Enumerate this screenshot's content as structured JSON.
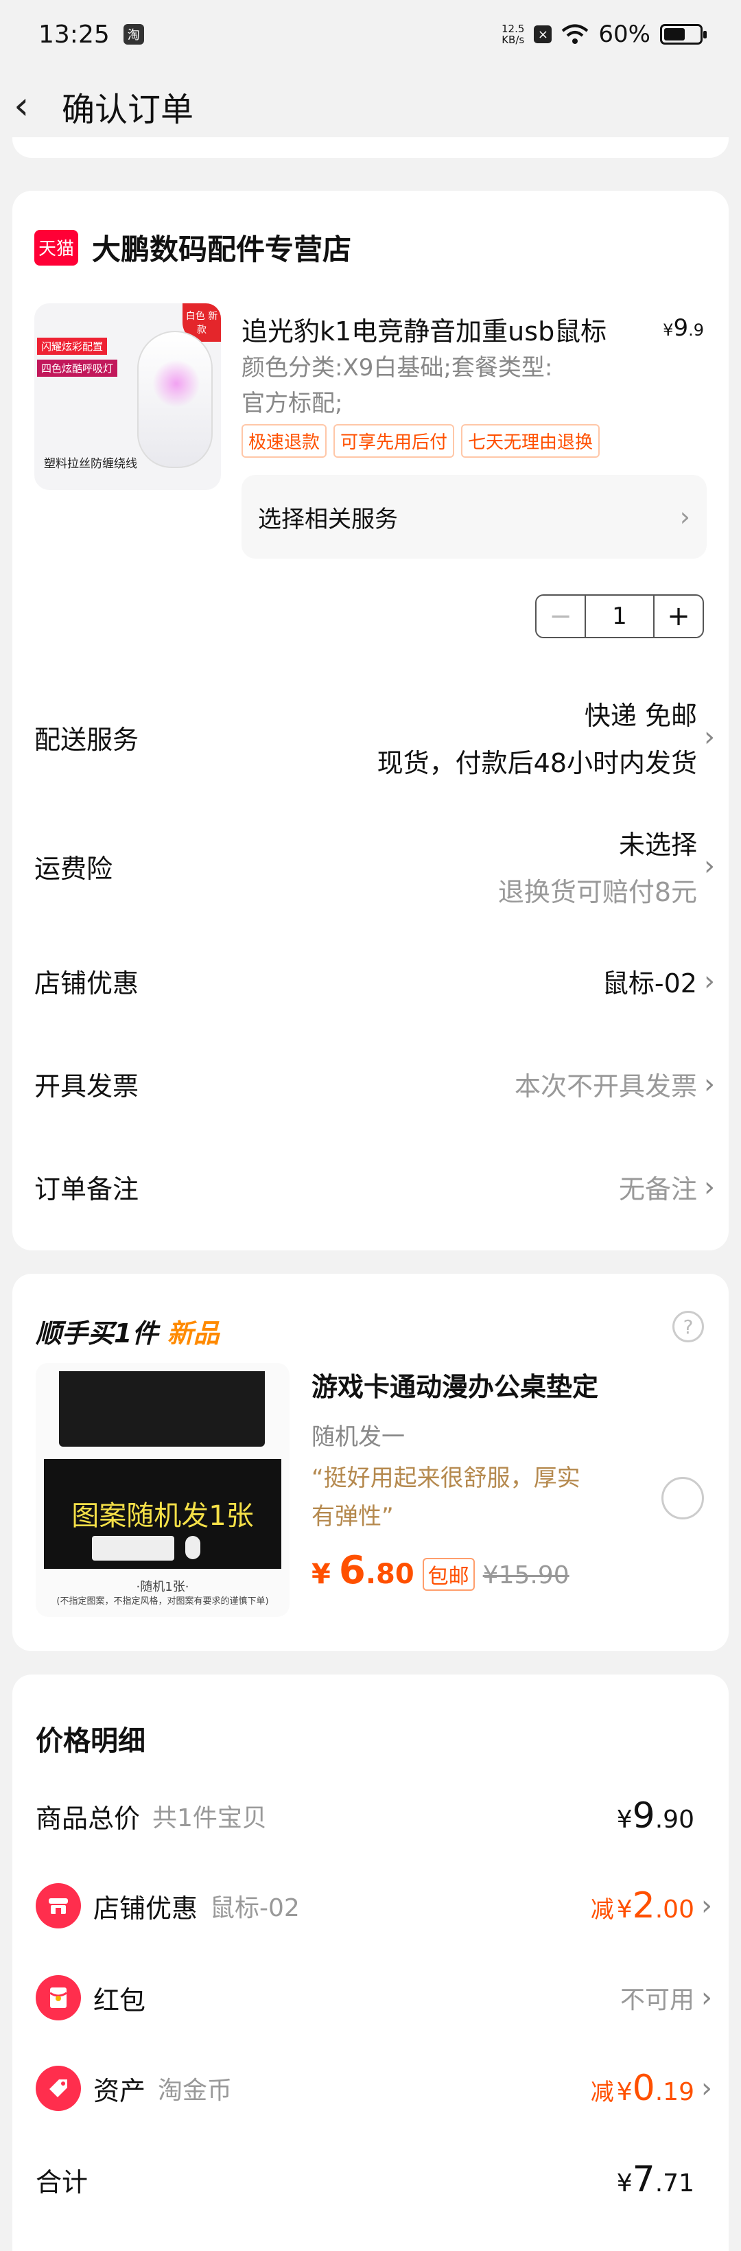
{
  "status": {
    "time": "13:25",
    "app_icon": "淘",
    "netspeed_value": "12.5",
    "netspeed_unit": "KB/s",
    "battery": "60%",
    "battery_level": 0.6
  },
  "nav": {
    "title": "确认订单"
  },
  "shop": {
    "badge": "天猫",
    "name": "大鹏数码配件专营店"
  },
  "product": {
    "title": "追光豹k1电竞静音加重usb鼠标",
    "price_symbol": "¥",
    "price_int": "9",
    "price_dec": ".9",
    "sku_line1": "颜色分类:X9白基础;套餐类型:",
    "sku_line2": "官方标配;",
    "badges": [
      "极速退款",
      "可享先用后付",
      "七天无理由退换"
    ],
    "image_tags": [
      "闪耀炫彩配置",
      "四色炫酷呼吸灯"
    ],
    "image_corner": "白色 新款",
    "image_caption": "塑料拉丝防缠绕线",
    "service_label": "选择相关服务",
    "quantity": "1",
    "minus": "−",
    "plus": "+"
  },
  "rows": {
    "delivery": {
      "label": "配送服务",
      "line1": "快递 免邮",
      "line2": "现货，付款后48小时内发货"
    },
    "insurance": {
      "label": "运费险",
      "line1": "未选择",
      "line2": "退换货可赔付8元"
    },
    "coupon": {
      "label": "店铺优惠",
      "value": "鼠标-02"
    },
    "invoice": {
      "label": "开具发票",
      "value": "本次不开具发票"
    },
    "note": {
      "label": "订单备注",
      "value": "无备注"
    }
  },
  "addon": {
    "title_prefix": "顺手买1件",
    "title_new": "新品",
    "help": "?",
    "image_text": "图案随机发1张",
    "image_sub1": "·随机1张·",
    "image_sub2": "(不指定图案，不指定风格，对图案有要求的谨慎下单)",
    "name": "游戏卡通动漫办公桌垫定",
    "sub": "随机发一",
    "review_line1": "“挺好用起来很舒服，厚实",
    "review_line2": "有弹性”",
    "price_symbol": "¥",
    "price_int": "6",
    "price_dec": ".80",
    "free_ship": "包邮",
    "orig_price": "¥15.90"
  },
  "price_detail": {
    "title": "价格明细",
    "goods_label": "商品总价",
    "goods_hint": "共1件宝贝",
    "goods_symbol": "¥",
    "goods_int": "9",
    "goods_dec": ".90",
    "shop_label": "店铺优惠",
    "shop_hint": "鼠标-02",
    "shop_reduce": "减",
    "shop_symbol": "¥",
    "shop_int": "2",
    "shop_dec": ".00",
    "redpacket_label": "红包",
    "redpacket_value": "不可用",
    "asset_label": "资产",
    "asset_hint": "淘金币",
    "asset_reduce": "减",
    "asset_symbol": "¥",
    "asset_int": "0",
    "asset_dec": ".19",
    "total_label": "合计",
    "total_symbol": "¥",
    "total_int": "7",
    "total_dec": ".71"
  },
  "colors": {
    "accent": "#ff5000",
    "tmall": "#ff0036",
    "review": "#b5894e"
  },
  "icons": [
    "back-arrow-icon",
    "wifi-icon",
    "battery-icon",
    "chevron-right-icon",
    "help-icon",
    "store-icon",
    "red-packet-icon",
    "coin-tag-icon"
  ]
}
